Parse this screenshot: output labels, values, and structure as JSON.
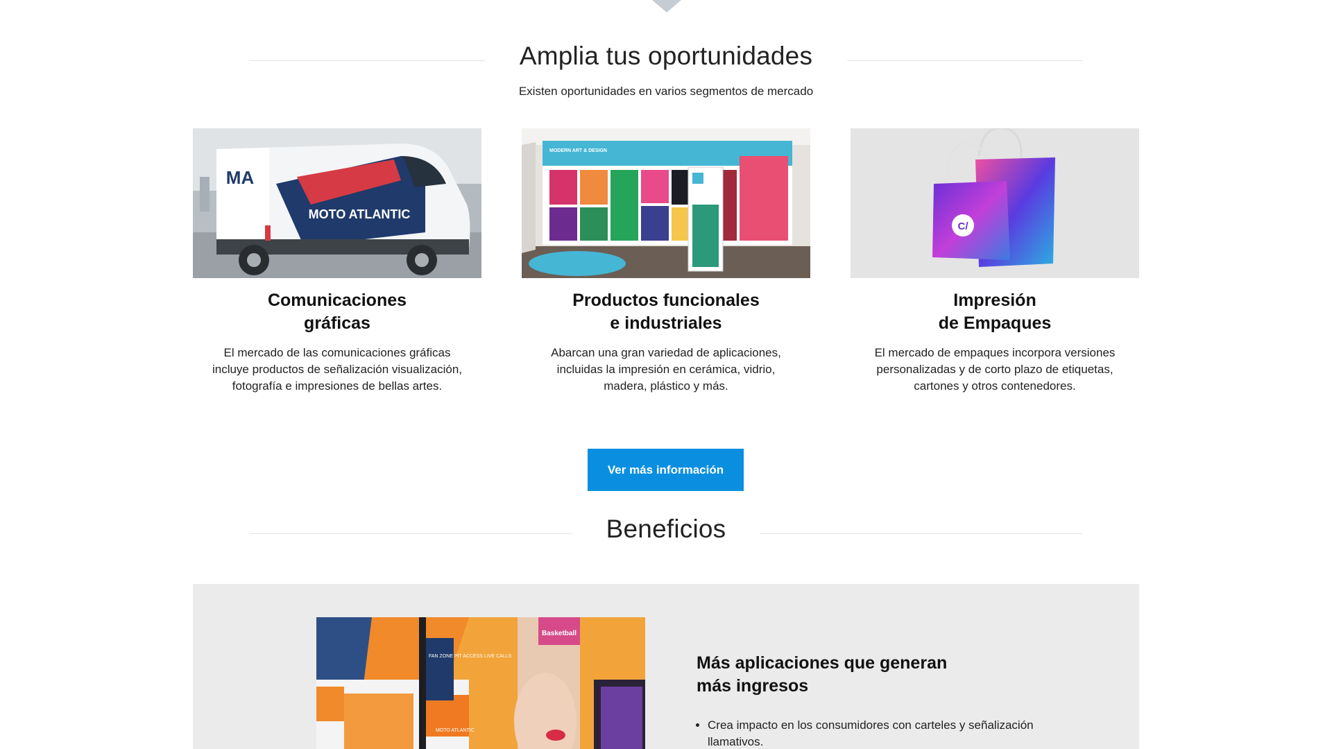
{
  "opportunities": {
    "title": "Amplia tus oportunidades",
    "subtitle": "Existen oportunidades en varios segmentos de mercado",
    "cards": [
      {
        "title_line1": "Comunicaciones",
        "title_line2": "gráficas",
        "description": "El mercado de las comunicaciones gráficas incluye productos de señalización visualización, fotografía e impresiones de bellas artes.",
        "image_text": "MOTO ATLANTIC",
        "image_logo": "MA"
      },
      {
        "title_line1": "Productos funcionales",
        "title_line2": "e industriales",
        "description": "Abarcan una gran variedad de aplicaciones, incluidas la impresión en cerámica, vidrio, madera, plástico y más.",
        "image_text": "MODERN ART & DESIGN"
      },
      {
        "title_line1": "Impresión",
        "title_line2": "de Empaques",
        "description": "El mercado de empaques incorpora versiones personalizadas y de corto plazo de etiquetas, cartones y otros contenedores.",
        "image_text": "C/"
      }
    ],
    "cta_label": "Ver más información"
  },
  "benefits": {
    "title": "Beneficios",
    "item_title_line1": "Más aplicaciones que generan",
    "item_title_line2": "más ingresos",
    "bullets": [
      "Crea impacto en los consumidores con carteles y señalización llamativos."
    ],
    "image_texts": {
      "banner": "FAN ZONE PIT ACCESS LIVE CALLS",
      "brand": "MOTO ATLANTIC",
      "sign": "Basketball"
    }
  },
  "colors": {
    "accent": "#0a8fe0",
    "panel": "#ebebeb",
    "rule": "#e3e3e3"
  }
}
